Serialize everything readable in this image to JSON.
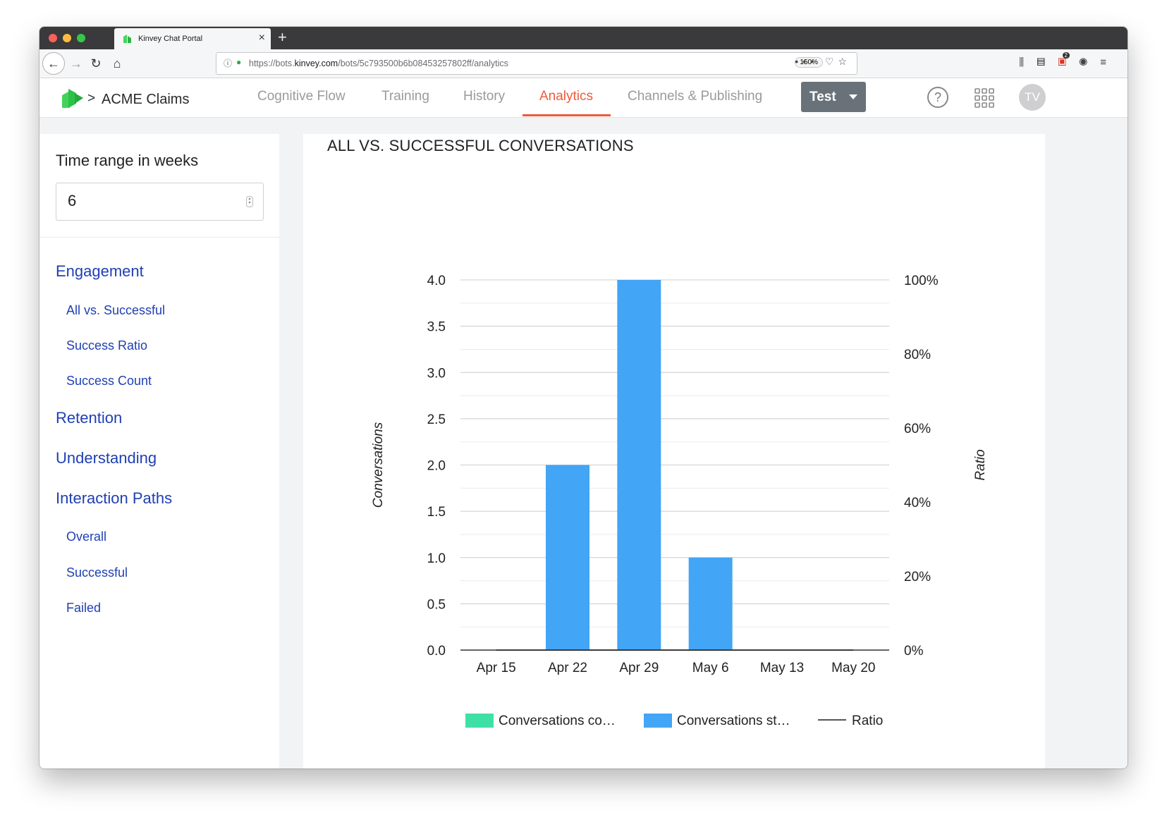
{
  "browser": {
    "tab_title": "Kinvey Chat Portal",
    "url_prefix": "https://bots.",
    "url_domain": "kinvey.com",
    "url_path": "/bots/5c793500b6b08453257802ff/analytics",
    "zoom": "150%",
    "badge_count": "2"
  },
  "app": {
    "breadcrumb_sep": ">",
    "name": "ACME Claims",
    "menu": [
      "Cognitive Flow",
      "Training",
      "History",
      "Analytics",
      "Channels & Publishing"
    ],
    "active_menu": "Analytics",
    "env_button": "Test",
    "help": "?",
    "avatar_initials": "TV",
    "accent_color": "#ef5a3c",
    "link_color": "#1f3fb3"
  },
  "sidebar": {
    "title": "Time range in weeks",
    "weeks_value": "6",
    "sections": [
      {
        "label": "Engagement",
        "items": [
          "All vs. Successful",
          "Success Ratio",
          "Success Count"
        ]
      },
      {
        "label": "Retention",
        "items": []
      },
      {
        "label": "Understanding",
        "items": []
      },
      {
        "label": "Interaction Paths",
        "items": [
          "Overall",
          "Successful",
          "Failed"
        ]
      }
    ]
  },
  "chart": {
    "title": "ALL VS. SUCCESSFUL CONVERSATIONS"
  },
  "chart_data": {
    "type": "bar",
    "categories": [
      "Apr 15",
      "Apr 22",
      "Apr 29",
      "May 6",
      "May 13",
      "May 20"
    ],
    "series": [
      {
        "name": "Conversations co…",
        "color": "#3fe0a6",
        "values": [
          0,
          0,
          0,
          0,
          0,
          0
        ]
      },
      {
        "name": "Conversations st…",
        "color": "#42a5f5",
        "values": [
          0,
          2,
          4,
          1,
          0,
          0
        ]
      },
      {
        "name": "Ratio",
        "color": "#555555",
        "type": "line",
        "axis": "right",
        "values": [
          0,
          0,
          0,
          0,
          0,
          0
        ]
      }
    ],
    "ylabel": "Conversations",
    "y2label": "Ratio",
    "ylim": [
      0,
      4
    ],
    "yticks": [
      "0.0",
      "0.5",
      "1.0",
      "1.5",
      "2.0",
      "2.5",
      "3.0",
      "3.5",
      "4.0"
    ],
    "y2lim": [
      0,
      100
    ],
    "y2ticks": [
      "0%",
      "20%",
      "40%",
      "60%",
      "80%",
      "100%"
    ],
    "grid": true,
    "legend_position": "bottom"
  }
}
